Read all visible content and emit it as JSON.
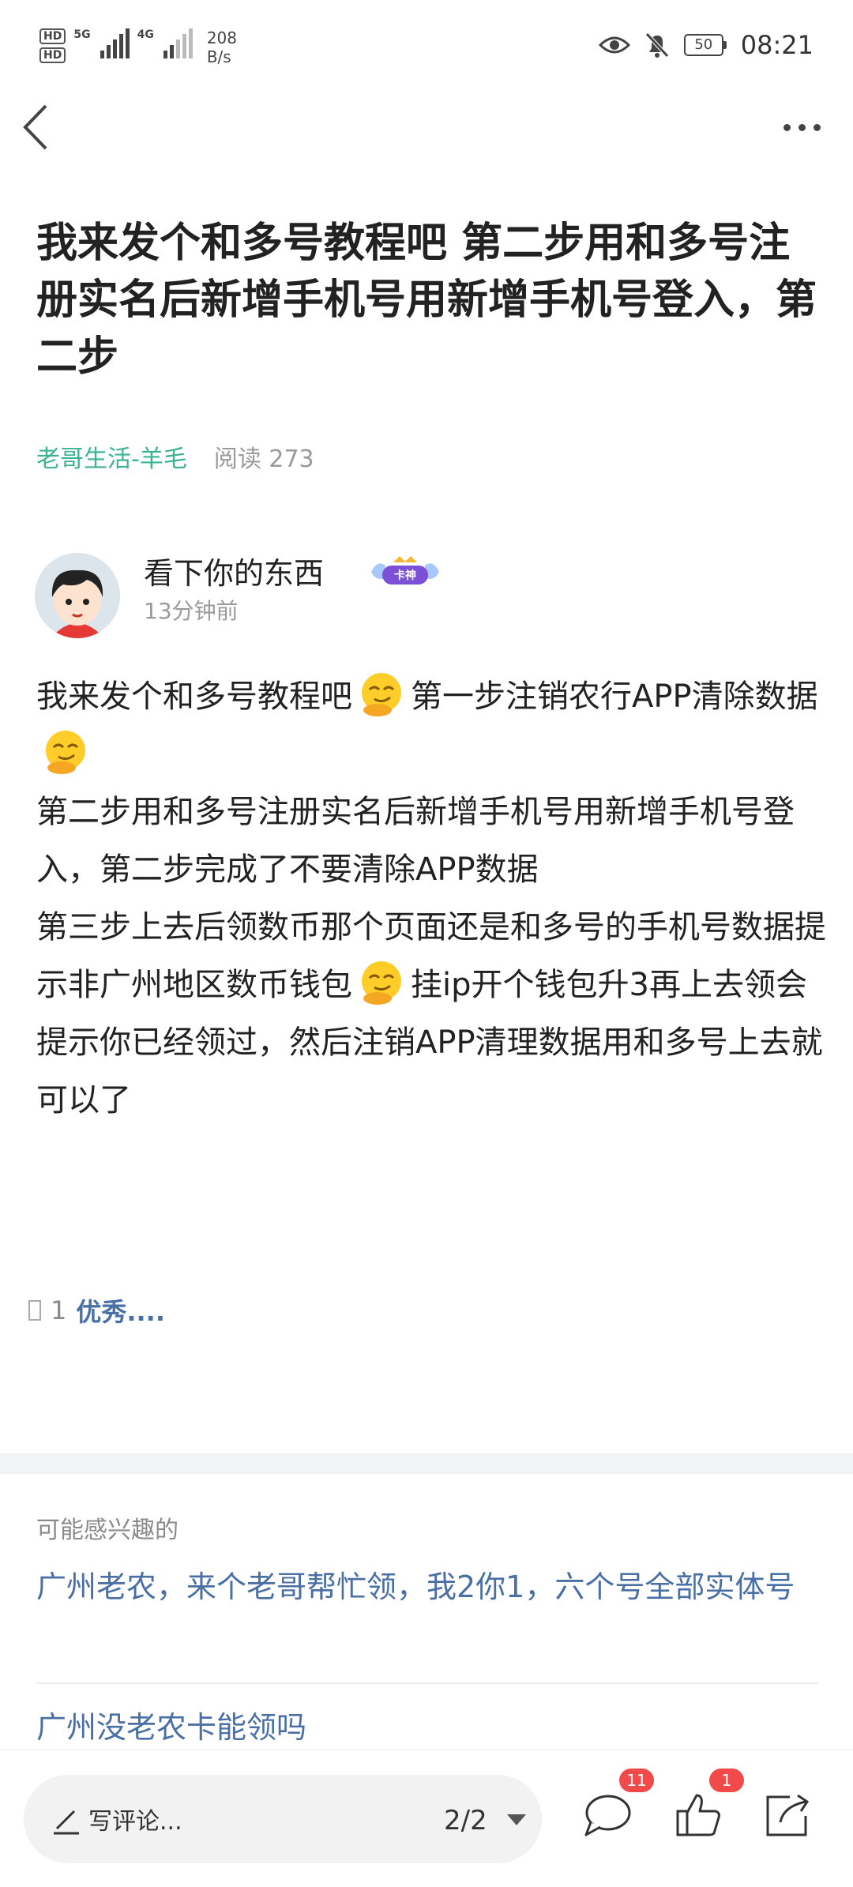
{
  "status_bar": {
    "hd_1": "HD",
    "hd_2": "HD",
    "net_1": "5G",
    "net_2": "4G",
    "speed_value": "208",
    "speed_unit": "B/s",
    "battery": "50",
    "time": "08:21"
  },
  "article": {
    "title": "我来发个和多号教程吧 第二步用和多号注册实名后新增手机号用新增手机号登入，第二步",
    "source": "老哥生活-羊毛",
    "read_count": "阅读 273"
  },
  "post": {
    "author": "看下你的东西",
    "badge": "卡神",
    "time_ago": "13分钟前",
    "p1_a": "我来发个和多号教程吧",
    "p1_b": "第一步注销农行APP清除数据",
    "p2": "第二步用和多号注册实名后新增手机号用新增手机号登入，第二步完成了不要清除APP数据",
    "p3_a": "第三步上去后领数币那个页面还是和多号的手机号数据提示非广州地区数币钱包",
    "p3_b": "挂ip开个钱包升3再上去领会提示你已经领过，然后注销APP清理数据用和多号上去就可以了"
  },
  "likes": {
    "count": "1",
    "label": "优秀...."
  },
  "recommend": {
    "heading": "可能感兴趣的",
    "items": [
      "广州老农，来个老哥帮忙领，我2你1，六个号全部实体号",
      "广州没老农卡能领吗"
    ]
  },
  "bottom_bar": {
    "comment_placeholder": "写评论...",
    "page_indicator": "2/2",
    "comment_count": "11",
    "like_count": "1"
  },
  "colors": {
    "accent_green": "#3bb38f",
    "link_blue": "#4a6fa5",
    "badge_red": "#f24a4a"
  }
}
